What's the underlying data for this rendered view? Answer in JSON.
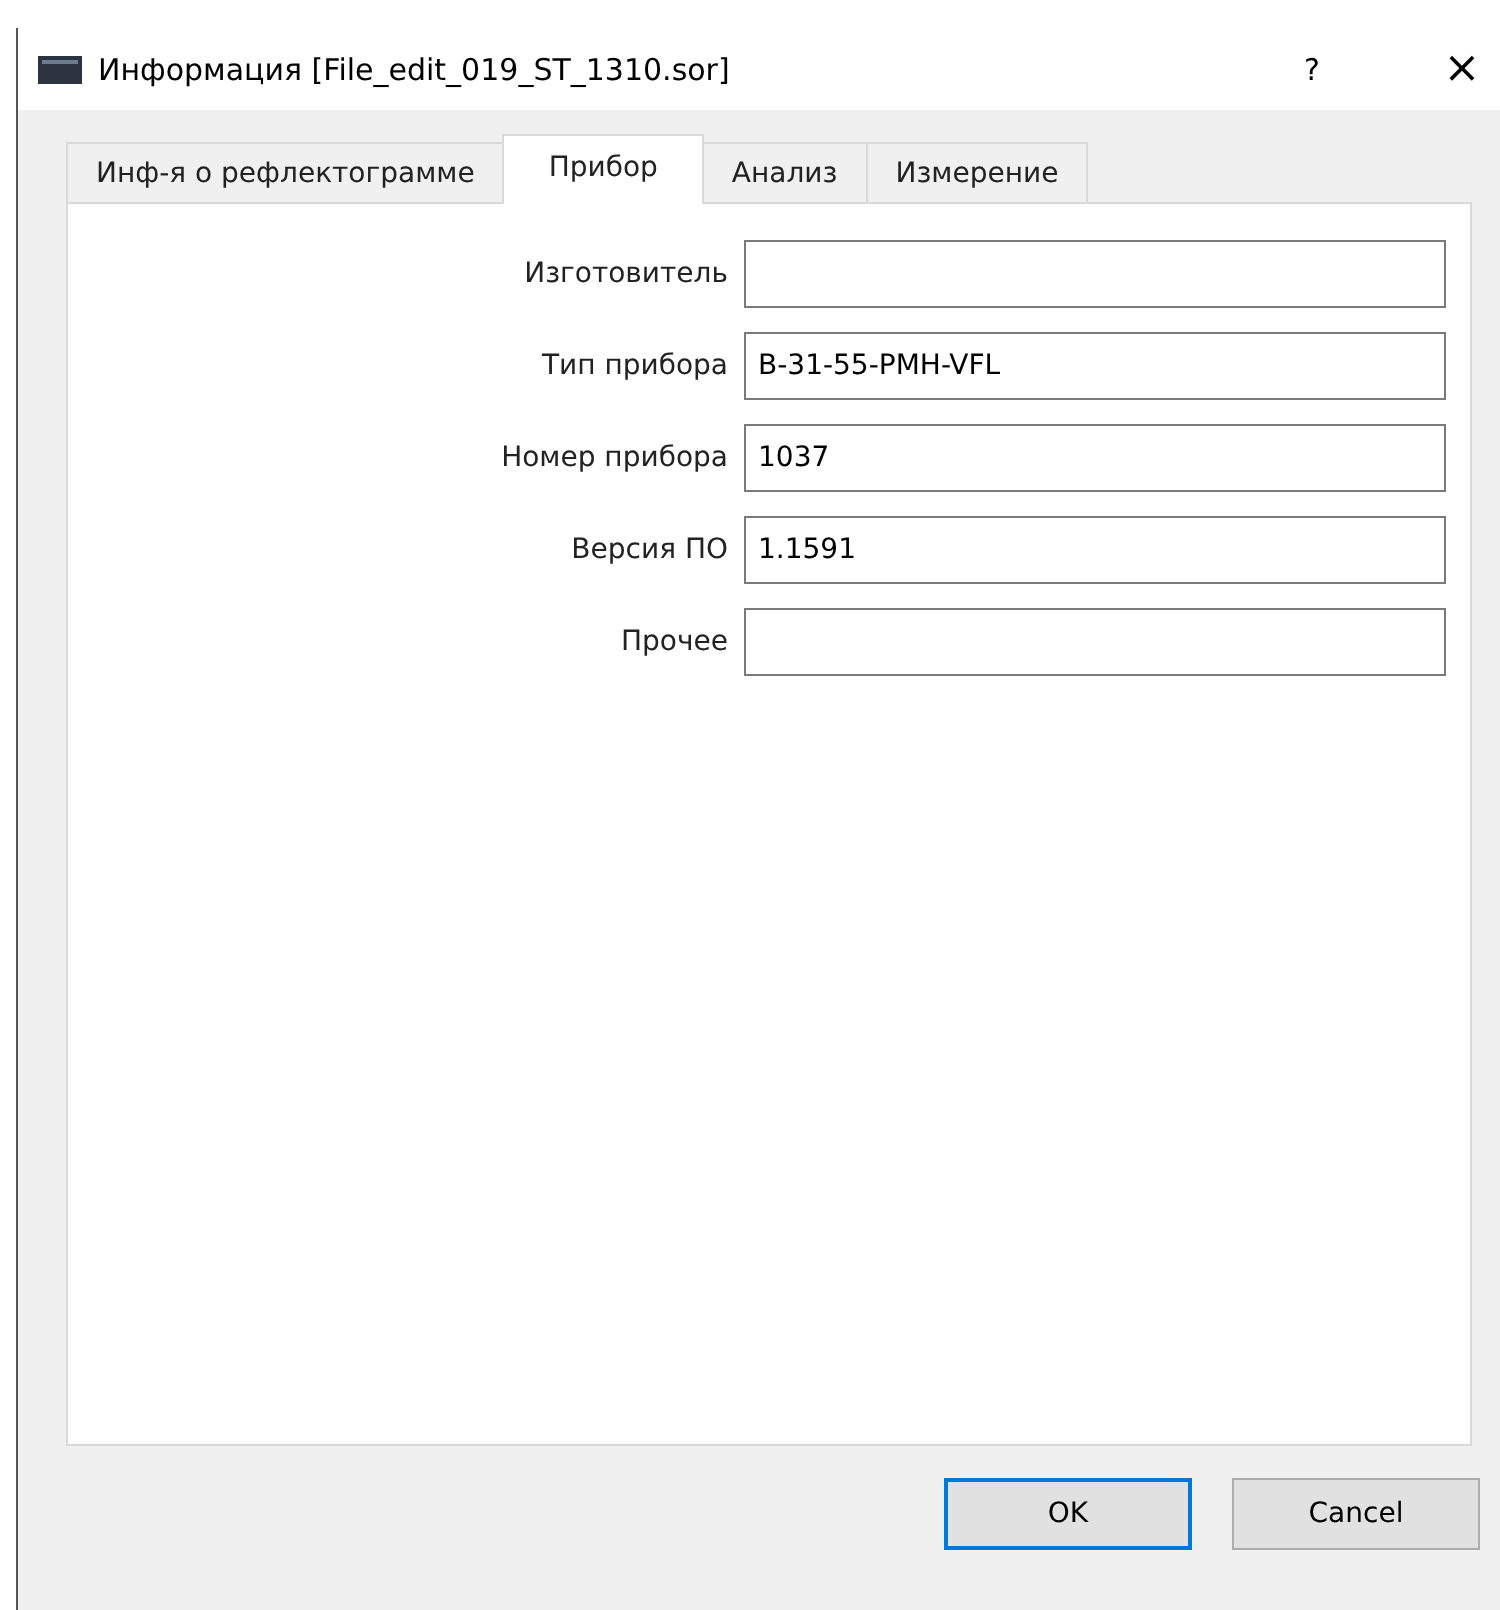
{
  "window": {
    "title": "Информация [File_edit_019_ST_1310.sor]",
    "help_button": "?",
    "close_button": "×"
  },
  "tabs": [
    {
      "label": "Инф-я о рефлектограмме",
      "selected": false
    },
    {
      "label": "Прибор",
      "selected": true
    },
    {
      "label": "Анализ",
      "selected": false
    },
    {
      "label": "Измерение",
      "selected": false
    }
  ],
  "fields": [
    {
      "label": "Изготовитель"
    },
    {
      "label": "Тип прибора",
      "value": "B-31-55-PMH-VFL"
    },
    {
      "label": "Номер прибора",
      "value": "1037"
    },
    {
      "label": "Версия ПО",
      "value": "1.1591"
    },
    {
      "label": "Прочее"
    }
  ],
  "buttons": [
    {
      "label": "OK",
      "default": true
    },
    {
      "label": "Cancel",
      "default": false
    }
  ]
}
